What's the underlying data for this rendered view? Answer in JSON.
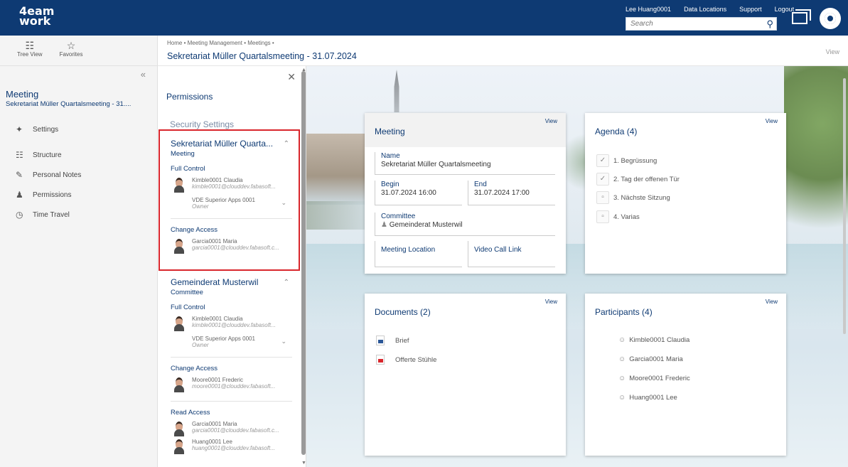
{
  "topbar": {
    "logo_line1": "4eam",
    "logo_line2": "work",
    "user": "Lee Huang0001",
    "links": [
      "Data Locations",
      "Support",
      "Logout"
    ],
    "search_placeholder": "Search"
  },
  "sidebar": {
    "tabs": [
      {
        "label": "Tree View",
        "icon": "tree-icon"
      },
      {
        "label": "Favorites",
        "icon": "star-icon"
      }
    ],
    "title": "Meeting",
    "subtitle": "Sekretariat Müller Quartalsmeeting - 31....",
    "items": [
      {
        "label": "Settings",
        "icon": "settings-icon"
      },
      {
        "label": "Structure",
        "icon": "structure-icon"
      },
      {
        "label": "Personal Notes",
        "icon": "notes-icon"
      },
      {
        "label": "Permissions",
        "icon": "permissions-icon"
      },
      {
        "label": "Time Travel",
        "icon": "clock-icon"
      }
    ]
  },
  "header": {
    "breadcrumb": "Home  •  Meeting Management  •  Meetings  •",
    "title": "Sekretariat Müller Quartalsmeeting - 31.07.2024",
    "view": "View"
  },
  "permissions": {
    "title": "Permissions",
    "security": "Security Settings",
    "group1": {
      "title": "Sekretariat Müller Quarta...",
      "type": "Meeting",
      "full_control": "Full Control",
      "fc_name": "Kimble0001 Claudia",
      "fc_mail": "kimble0001@clouddev.fabasoft...",
      "owner_name": "VDE Superior Apps 0001",
      "owner_role": "Owner",
      "change_access": "Change Access",
      "ca_name": "Garcia0001 Maria",
      "ca_mail": "garcia0001@clouddev.fabasoft.c..."
    },
    "group2": {
      "title": "Gemeinderat Musterwil",
      "type": "Committee",
      "full_control": "Full Control",
      "fc_name": "Kimble0001 Claudia",
      "fc_mail": "kimble0001@clouddev.fabasoft...",
      "owner_name": "VDE Superior Apps 0001",
      "owner_role": "Owner",
      "change_access": "Change Access",
      "ca_name": "Moore0001 Frederic",
      "ca_mail": "moore0001@clouddev.fabasoft...",
      "read_access": "Read Access",
      "ra1_name": "Garcia0001 Maria",
      "ra1_mail": "garcia0001@clouddev.fabasoft.c...",
      "ra2_name": "Huang0001 Lee",
      "ra2_mail": "huang0001@clouddev.fabasoft..."
    }
  },
  "meeting_card": {
    "view": "View",
    "title": "Meeting",
    "name_label": "Name",
    "name_value": "Sekretariat Müller Quartalsmeeting",
    "begin_label": "Begin",
    "begin_value": "31.07.2024 16:00",
    "end_label": "End",
    "end_value": "31.07.2024 17:00",
    "committee_label": "Committee",
    "committee_value": "Gemeinderat Musterwil",
    "location_label": "Meeting Location",
    "video_label": "Video Call Link"
  },
  "agenda_card": {
    "view": "View",
    "title": "Agenda (4)",
    "items": [
      "1. Begrüssung",
      "2. Tag der offenen Tür",
      "3. Nächste Sitzung",
      "4. Varias"
    ]
  },
  "documents_card": {
    "view": "View",
    "title": "Documents (2)",
    "items": [
      "Brief",
      "Offerte Stühle"
    ]
  },
  "participants_card": {
    "view": "View",
    "title": "Participants (4)",
    "items": [
      "Kimble0001 Claudia",
      "Garcia0001 Maria",
      "Moore0001 Frederic",
      "Huang0001 Lee"
    ]
  },
  "colors": {
    "brand": "#0e3a73",
    "highlight": "#d9262c"
  }
}
